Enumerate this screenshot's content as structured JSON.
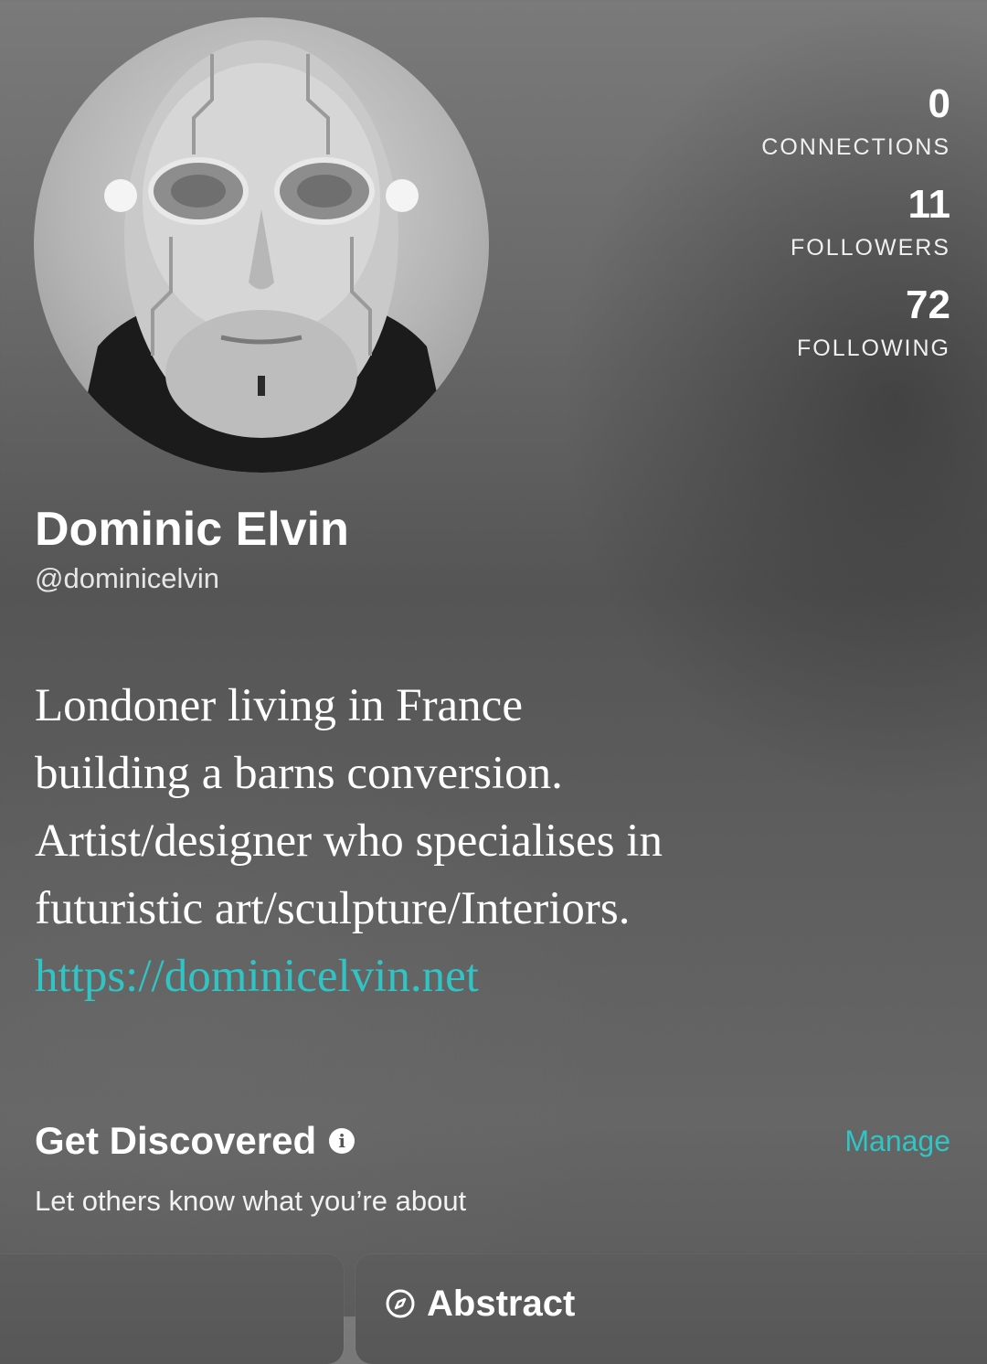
{
  "profile": {
    "name": "Dominic Elvin",
    "handle": "@dominicelvin",
    "avatar_icon": "profile-photo"
  },
  "stats": [
    {
      "count": "0",
      "label": "CONNECTIONS"
    },
    {
      "count": "11",
      "label": "FOLLOWERS"
    },
    {
      "count": "72",
      "label": "FOLLOWING"
    }
  ],
  "bio": {
    "lines": [
      "Londoner living in France",
      "building a barns conversion.",
      "Artist/designer who specialises in",
      "futuristic art/sculpture/Interiors."
    ],
    "link": "https://dominicelvin.net"
  },
  "discover": {
    "title": "Get Discovered",
    "info_icon": "info-icon",
    "manage_label": "Manage",
    "subtitle": "Let others know what you’re about"
  },
  "categories": [
    {
      "label": ""
    },
    {
      "label": "Abstract",
      "icon": "compass-icon"
    }
  ],
  "colors": {
    "accent": "#31c4c4",
    "text": "#ffffff"
  }
}
